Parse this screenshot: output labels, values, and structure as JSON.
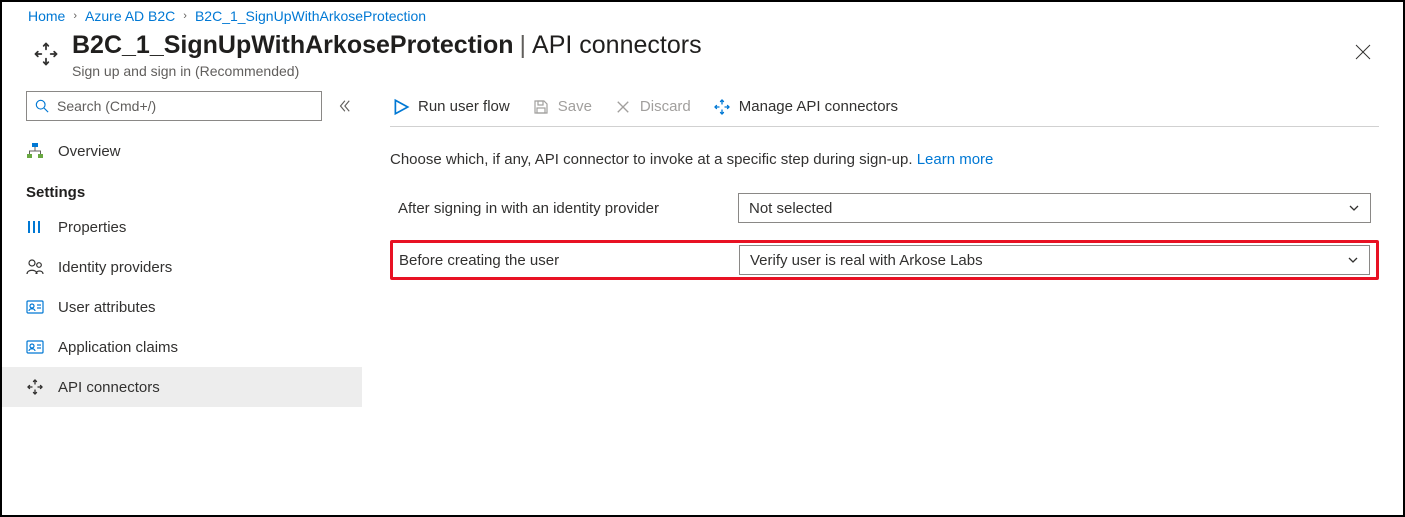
{
  "breadcrumb": {
    "home": "Home",
    "level1": "Azure AD B2C",
    "level2": "B2C_1_SignUpWithArkoseProtection"
  },
  "header": {
    "title_main": "B2C_1_SignUpWithArkoseProtection",
    "title_sub": "API connectors",
    "subtitle": "Sign up and sign in (Recommended)"
  },
  "search": {
    "placeholder": "Search (Cmd+/)"
  },
  "sidebar": {
    "overview": "Overview",
    "settings_heading": "Settings",
    "properties": "Properties",
    "identity_providers": "Identity providers",
    "user_attributes": "User attributes",
    "application_claims": "Application claims",
    "api_connectors": "API connectors"
  },
  "toolbar": {
    "run": "Run user flow",
    "save": "Save",
    "discard": "Discard",
    "manage": "Manage API connectors"
  },
  "content": {
    "description": "Choose which, if any, API connector to invoke at a specific step during sign-up.",
    "learn_more": "Learn more",
    "row1_label": "After signing in with an identity provider",
    "row1_value": "Not selected",
    "row2_label": "Before creating the user",
    "row2_value": "Verify user is real with Arkose Labs"
  },
  "colors": {
    "link": "#0078d4",
    "highlight": "#e81123",
    "muted": "#605e5c"
  }
}
